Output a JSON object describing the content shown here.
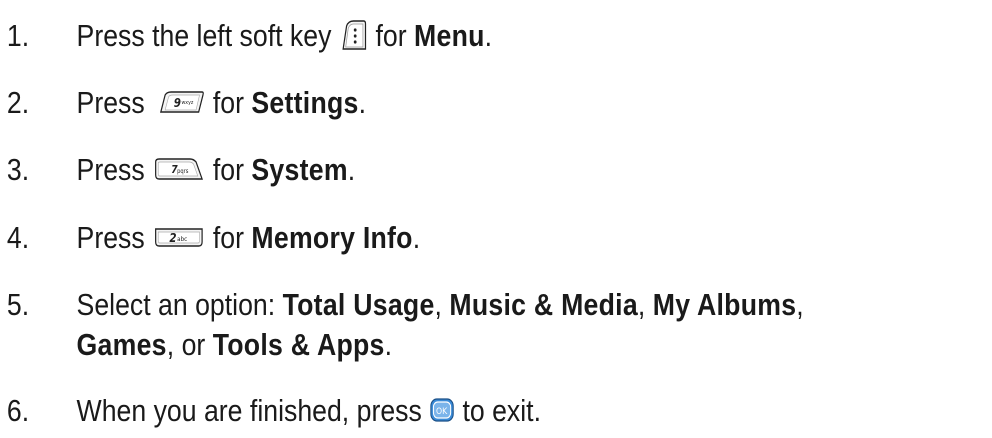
{
  "steps": [
    {
      "number": "1.",
      "text_before": "Press the left soft key",
      "key_icon": "left-soft-key-icon",
      "key_label": "",
      "text_mid": "for",
      "bold": "Menu",
      "text_after": "."
    },
    {
      "number": "2.",
      "text_before": "Press",
      "key_icon": "key-9-icon",
      "key_label": "9",
      "key_sub": "wxyz",
      "text_mid": "for",
      "bold": "Settings",
      "text_after": "."
    },
    {
      "number": "3.",
      "text_before": "Press",
      "key_icon": "key-7-icon",
      "key_label": "7",
      "key_sub": "pqrs",
      "text_mid": "for",
      "bold": "System",
      "text_after": "."
    },
    {
      "number": "4.",
      "text_before": "Press",
      "key_icon": "key-2-icon",
      "key_label": "2",
      "key_sub": "abc",
      "text_mid": "for",
      "bold": "Memory Info",
      "text_after": "."
    },
    {
      "number": "5.",
      "text_before": "Select an option:",
      "options": [
        "Total Usage",
        "Music & Media",
        "My Albums",
        "Games",
        "Tools & Apps"
      ],
      "sep1": ",",
      "sep2": ",",
      "sep3": ",",
      "sep4": ", or",
      "text_after": "."
    },
    {
      "number": "6.",
      "text_before": "When you are finished, press",
      "key_icon": "ok-key-icon",
      "key_label": "OK",
      "text_after": "to exit."
    }
  ],
  "colors": {
    "text": "#1a1a1a",
    "ok_key": "#3a8ad6"
  }
}
